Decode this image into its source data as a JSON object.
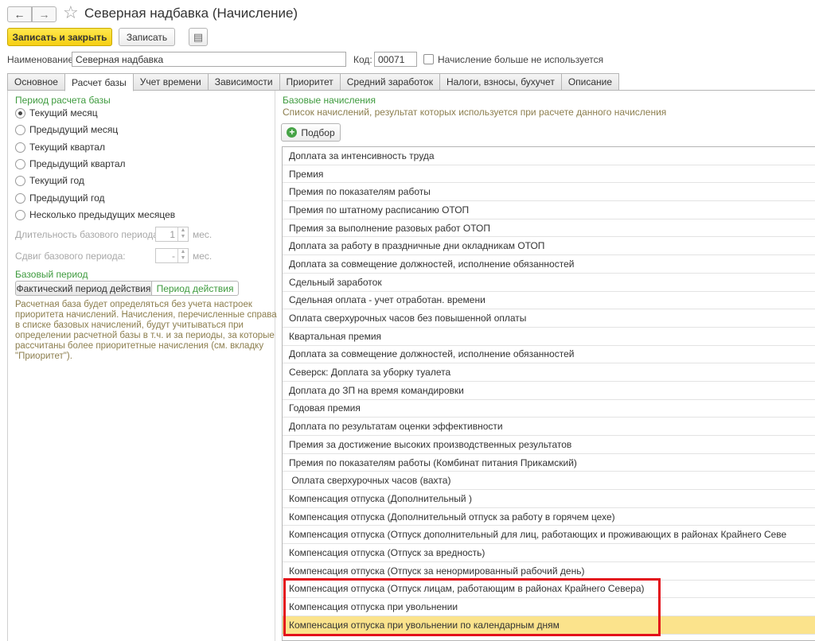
{
  "window": {
    "title": "Северная надбавка (Начисление)",
    "back_icon": "←",
    "forward_icon": "→",
    "star_icon": "☆"
  },
  "toolbar": {
    "save_close_label": "Записать и закрыть",
    "save_label": "Записать",
    "more_icon": "▤"
  },
  "form": {
    "name_label": "Наименование:",
    "name_value": "Северная надбавка",
    "code_label": "Код:",
    "code_value": "00071",
    "not_used_label": "Начисление больше не используется"
  },
  "tabs": [
    {
      "label": "Основное"
    },
    {
      "label": "Расчет базы"
    },
    {
      "label": "Учет времени"
    },
    {
      "label": "Зависимости"
    },
    {
      "label": "Приоритет"
    },
    {
      "label": "Средний заработок"
    },
    {
      "label": "Налоги, взносы, бухучет"
    },
    {
      "label": "Описание"
    }
  ],
  "period": {
    "title": "Период расчета базы",
    "options": [
      {
        "label": "Текущий месяц"
      },
      {
        "label": "Предыдущий месяц"
      },
      {
        "label": "Текущий квартал"
      },
      {
        "label": "Предыдущий квартал"
      },
      {
        "label": "Текущий год"
      },
      {
        "label": "Предыдущий год"
      },
      {
        "label": "Несколько предыдущих месяцев"
      }
    ],
    "duration_label": "Длительность базового периода:",
    "duration_value": "1",
    "duration_unit": "мес.",
    "shift_label": "Сдвиг базового периода:",
    "shift_value": "-",
    "shift_unit": "мес."
  },
  "base_period": {
    "title": "Базовый период",
    "actual_label": "Фактический период действия",
    "period_label": "Период действия",
    "note": "Расчетная база будет определяться без учета настроек приоритета начислений. Начисления, перечисленные справа в списке базовых начислений, будут учитываться при определении расчетной базы в т.ч. и за периоды, за которые рассчитаны более приоритетные начисления (см. вкладку \"Приоритет\")."
  },
  "base_accruals": {
    "title": "Базовые начисления",
    "description": "Список начислений, результат которых используется при расчете данного начисления",
    "pick_label": "Подбор",
    "pick_icon": "+",
    "items": [
      "Доплата за интенсивность труда",
      "Премия",
      "Премия по показателям работы",
      "Премия по штатному расписанию ОТОП",
      "Премия за выполнение разовых работ ОТОП",
      "Доплата за работу в праздничные дни окладникам ОТОП",
      "Доплата за совмещение должностей, исполнение обязанностей",
      "Сдельный заработок",
      "Сдельная оплата - учет отработан. времени",
      "Оплата сверхурочных часов без повышенной оплаты",
      "Квартальная премия",
      "Доплата за совмещение должностей, исполнение обязанностей",
      "Северск: Доплата за уборку туалета",
      "Доплата до ЗП на время командировки",
      "Годовая премия",
      "Доплата по результатам оценки эффективности",
      "Премия за достижение высоких производственных результатов",
      "Премия по показателям работы (Комбинат питания Прикамский)",
      " Оплата сверхурочных часов (вахта)",
      "Компенсация отпуска (Дополнительный )",
      "Компенсация отпуска (Дополнительный отпуск за работу в горячем цехе)",
      "Компенсация отпуска (Отпуск дополнительный для лиц, работающих и проживающих в районах Крайнего Севе",
      "Компенсация отпуска (Отпуск за вредность)",
      "Компенсация отпуска (Отпуск за ненормированный рабочий день)",
      "Компенсация отпуска (Отпуск лицам, работающим в районах Крайнего Севера)",
      "Компенсация отпуска при увольнении",
      "Компенсация отпуска при увольнении по календарным дням"
    ]
  }
}
